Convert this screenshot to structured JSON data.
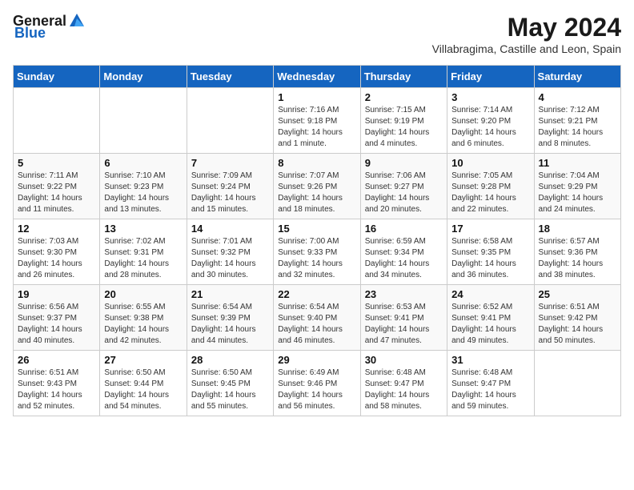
{
  "header": {
    "logo_general": "General",
    "logo_blue": "Blue",
    "month_year": "May 2024",
    "location": "Villabragima, Castille and Leon, Spain"
  },
  "weekdays": [
    "Sunday",
    "Monday",
    "Tuesday",
    "Wednesday",
    "Thursday",
    "Friday",
    "Saturday"
  ],
  "weeks": [
    [
      {
        "day": "",
        "info": ""
      },
      {
        "day": "",
        "info": ""
      },
      {
        "day": "",
        "info": ""
      },
      {
        "day": "1",
        "info": "Sunrise: 7:16 AM\nSunset: 9:18 PM\nDaylight: 14 hours\nand 1 minute."
      },
      {
        "day": "2",
        "info": "Sunrise: 7:15 AM\nSunset: 9:19 PM\nDaylight: 14 hours\nand 4 minutes."
      },
      {
        "day": "3",
        "info": "Sunrise: 7:14 AM\nSunset: 9:20 PM\nDaylight: 14 hours\nand 6 minutes."
      },
      {
        "day": "4",
        "info": "Sunrise: 7:12 AM\nSunset: 9:21 PM\nDaylight: 14 hours\nand 8 minutes."
      }
    ],
    [
      {
        "day": "5",
        "info": "Sunrise: 7:11 AM\nSunset: 9:22 PM\nDaylight: 14 hours\nand 11 minutes."
      },
      {
        "day": "6",
        "info": "Sunrise: 7:10 AM\nSunset: 9:23 PM\nDaylight: 14 hours\nand 13 minutes."
      },
      {
        "day": "7",
        "info": "Sunrise: 7:09 AM\nSunset: 9:24 PM\nDaylight: 14 hours\nand 15 minutes."
      },
      {
        "day": "8",
        "info": "Sunrise: 7:07 AM\nSunset: 9:26 PM\nDaylight: 14 hours\nand 18 minutes."
      },
      {
        "day": "9",
        "info": "Sunrise: 7:06 AM\nSunset: 9:27 PM\nDaylight: 14 hours\nand 20 minutes."
      },
      {
        "day": "10",
        "info": "Sunrise: 7:05 AM\nSunset: 9:28 PM\nDaylight: 14 hours\nand 22 minutes."
      },
      {
        "day": "11",
        "info": "Sunrise: 7:04 AM\nSunset: 9:29 PM\nDaylight: 14 hours\nand 24 minutes."
      }
    ],
    [
      {
        "day": "12",
        "info": "Sunrise: 7:03 AM\nSunset: 9:30 PM\nDaylight: 14 hours\nand 26 minutes."
      },
      {
        "day": "13",
        "info": "Sunrise: 7:02 AM\nSunset: 9:31 PM\nDaylight: 14 hours\nand 28 minutes."
      },
      {
        "day": "14",
        "info": "Sunrise: 7:01 AM\nSunset: 9:32 PM\nDaylight: 14 hours\nand 30 minutes."
      },
      {
        "day": "15",
        "info": "Sunrise: 7:00 AM\nSunset: 9:33 PM\nDaylight: 14 hours\nand 32 minutes."
      },
      {
        "day": "16",
        "info": "Sunrise: 6:59 AM\nSunset: 9:34 PM\nDaylight: 14 hours\nand 34 minutes."
      },
      {
        "day": "17",
        "info": "Sunrise: 6:58 AM\nSunset: 9:35 PM\nDaylight: 14 hours\nand 36 minutes."
      },
      {
        "day": "18",
        "info": "Sunrise: 6:57 AM\nSunset: 9:36 PM\nDaylight: 14 hours\nand 38 minutes."
      }
    ],
    [
      {
        "day": "19",
        "info": "Sunrise: 6:56 AM\nSunset: 9:37 PM\nDaylight: 14 hours\nand 40 minutes."
      },
      {
        "day": "20",
        "info": "Sunrise: 6:55 AM\nSunset: 9:38 PM\nDaylight: 14 hours\nand 42 minutes."
      },
      {
        "day": "21",
        "info": "Sunrise: 6:54 AM\nSunset: 9:39 PM\nDaylight: 14 hours\nand 44 minutes."
      },
      {
        "day": "22",
        "info": "Sunrise: 6:54 AM\nSunset: 9:40 PM\nDaylight: 14 hours\nand 46 minutes."
      },
      {
        "day": "23",
        "info": "Sunrise: 6:53 AM\nSunset: 9:41 PM\nDaylight: 14 hours\nand 47 minutes."
      },
      {
        "day": "24",
        "info": "Sunrise: 6:52 AM\nSunset: 9:41 PM\nDaylight: 14 hours\nand 49 minutes."
      },
      {
        "day": "25",
        "info": "Sunrise: 6:51 AM\nSunset: 9:42 PM\nDaylight: 14 hours\nand 50 minutes."
      }
    ],
    [
      {
        "day": "26",
        "info": "Sunrise: 6:51 AM\nSunset: 9:43 PM\nDaylight: 14 hours\nand 52 minutes."
      },
      {
        "day": "27",
        "info": "Sunrise: 6:50 AM\nSunset: 9:44 PM\nDaylight: 14 hours\nand 54 minutes."
      },
      {
        "day": "28",
        "info": "Sunrise: 6:50 AM\nSunset: 9:45 PM\nDaylight: 14 hours\nand 55 minutes."
      },
      {
        "day": "29",
        "info": "Sunrise: 6:49 AM\nSunset: 9:46 PM\nDaylight: 14 hours\nand 56 minutes."
      },
      {
        "day": "30",
        "info": "Sunrise: 6:48 AM\nSunset: 9:47 PM\nDaylight: 14 hours\nand 58 minutes."
      },
      {
        "day": "31",
        "info": "Sunrise: 6:48 AM\nSunset: 9:47 PM\nDaylight: 14 hours\nand 59 minutes."
      },
      {
        "day": "",
        "info": ""
      }
    ]
  ]
}
